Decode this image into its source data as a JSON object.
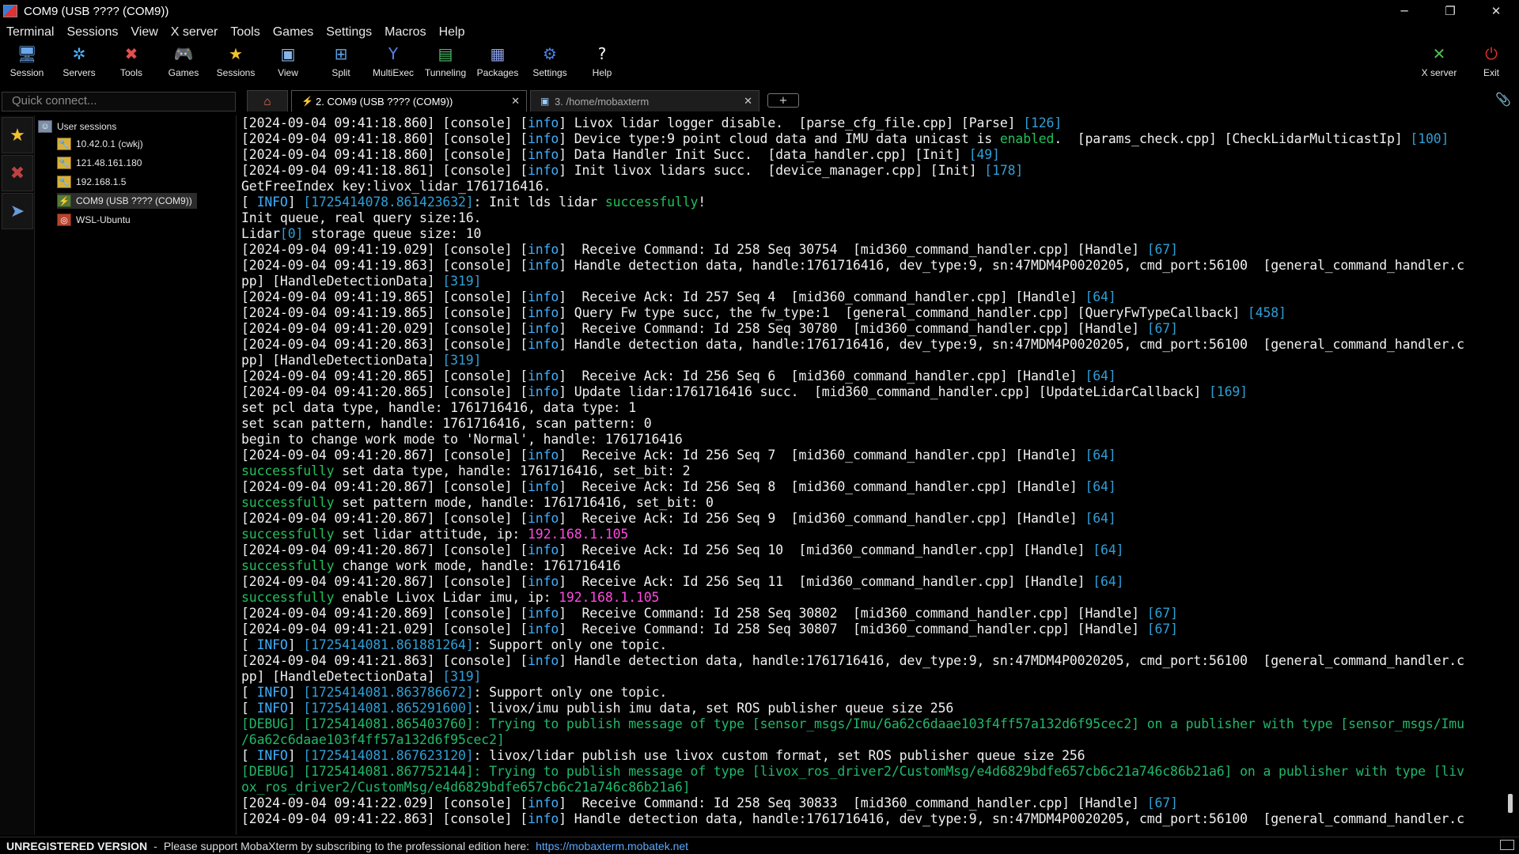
{
  "window": {
    "title": "COM9  (USB ???? (COM9))",
    "controls": {
      "minimize": "─",
      "restore": "❐",
      "close": "✕"
    }
  },
  "menubar": [
    "Terminal",
    "Sessions",
    "View",
    "X server",
    "Tools",
    "Games",
    "Settings",
    "Macros",
    "Help"
  ],
  "toolbar": {
    "left": [
      {
        "label": "Session",
        "icon": "session-icon",
        "glyph": "🖥",
        "color": "#6aa6e8"
      },
      {
        "label": "Servers",
        "icon": "servers-icon",
        "glyph": "✲",
        "color": "#4db3ff"
      },
      {
        "label": "Tools",
        "icon": "tools-icon",
        "glyph": "✖",
        "color": "#e05050"
      },
      {
        "label": "Games",
        "icon": "games-icon",
        "glyph": "🎮",
        "color": "#dddddd"
      },
      {
        "label": "Sessions",
        "icon": "star-icon",
        "glyph": "★",
        "color": "#f2c12e"
      },
      {
        "label": "View",
        "icon": "view-icon",
        "glyph": "▣",
        "color": "#8ab4e8"
      },
      {
        "label": "Split",
        "icon": "split-icon",
        "glyph": "⊞",
        "color": "#5aa0e0"
      },
      {
        "label": "MultiExec",
        "icon": "multiexec-icon",
        "glyph": "Y",
        "color": "#5a7fe0"
      },
      {
        "label": "Tunneling",
        "icon": "tunneling-icon",
        "glyph": "▤",
        "color": "#4fbf6a"
      },
      {
        "label": "Packages",
        "icon": "packages-icon",
        "glyph": "▦",
        "color": "#8aa0e8"
      },
      {
        "label": "Settings",
        "icon": "settings-icon",
        "glyph": "⚙",
        "color": "#4a80e0"
      },
      {
        "label": "Help",
        "icon": "help-icon",
        "glyph": "?",
        "color": "#ffffff"
      }
    ],
    "right": [
      {
        "label": "X server",
        "icon": "xserver-icon",
        "glyph": "✕",
        "color": "#4fbf4f"
      },
      {
        "label": "Exit",
        "icon": "power-icon",
        "glyph": "⏻",
        "color": "#e03030"
      }
    ]
  },
  "quick_connect": {
    "placeholder": "Quick connect..."
  },
  "tabs": {
    "home_glyph": "⌂",
    "items": [
      {
        "label": "2. COM9  (USB ???? (COM9))",
        "glyph": "⚡",
        "active": true
      },
      {
        "label": "3. /home/mobaxterm",
        "glyph": "▣",
        "active": false
      }
    ],
    "new_tab": "+",
    "clip_glyph": "📎"
  },
  "side_rail": [
    {
      "icon": "star-icon",
      "glyph": "★",
      "color": "#f2c12e"
    },
    {
      "icon": "tools-icon",
      "glyph": "✖",
      "color": "#c04040"
    },
    {
      "icon": "send-icon",
      "glyph": "➤",
      "color": "#6a9ad8"
    }
  ],
  "sessions_tree": {
    "root": "User sessions",
    "items": [
      {
        "label": "10.42.0.1 (cwkj)",
        "type": "ssh"
      },
      {
        "label": "121.48.161.180",
        "type": "ssh"
      },
      {
        "label": "192.168.1.5",
        "type": "ssh"
      },
      {
        "label": "COM9  (USB ???? (COM9))",
        "type": "serial",
        "selected": true
      },
      {
        "label": "WSL-Ubuntu",
        "type": "wsl"
      }
    ]
  },
  "terminal": {
    "lines": [
      [
        [
          "[2024-09-04 09:41:18.860] [console] [",
          ""
        ],
        [
          "info",
          "info"
        ],
        [
          "] Livox lidar logger disable.  [parse_cfg_file.cpp] [Parse] ",
          ""
        ],
        [
          "[126]",
          "num"
        ]
      ],
      [
        [
          "[2024-09-04 09:41:18.860] [console] [",
          ""
        ],
        [
          "info",
          "info"
        ],
        [
          "] Device type:9 point cloud data and IMU data unicast is ",
          ""
        ],
        [
          "enabled",
          "green"
        ],
        [
          ".  [params_check.cpp] [CheckLidarMulticastIp] ",
          ""
        ],
        [
          "[100]",
          "num"
        ]
      ],
      [
        [
          "[2024-09-04 09:41:18.860] [console] [",
          ""
        ],
        [
          "info",
          "info"
        ],
        [
          "] Data Handler Init Succ.  [data_handler.cpp] [Init] ",
          ""
        ],
        [
          "[49]",
          "num"
        ]
      ],
      [
        [
          "[2024-09-04 09:41:18.861] [console] [",
          ""
        ],
        [
          "info",
          "info"
        ],
        [
          "] Init livox lidars succ.  [device_manager.cpp] [Init] ",
          ""
        ],
        [
          "[178]",
          "num"
        ]
      ],
      [
        [
          "GetFreeIndex key:livox_lidar_1761716416.",
          ""
        ]
      ],
      [
        [
          "[ ",
          ""
        ],
        [
          "INFO",
          "info"
        ],
        [
          "] ",
          ""
        ],
        [
          "[1725414078.861423632]",
          "num"
        ],
        [
          ": Init lds lidar ",
          ""
        ],
        [
          "successfully",
          "green"
        ],
        [
          "!",
          ""
        ]
      ],
      [
        [
          "Init queue, real query size:16.",
          ""
        ]
      ],
      [
        [
          "Lidar",
          ""
        ],
        [
          "[0]",
          "num"
        ],
        [
          " storage queue size: 10",
          ""
        ]
      ],
      [
        [
          "[2024-09-04 09:41:19.029] [console] [",
          ""
        ],
        [
          "info",
          "info"
        ],
        [
          "]  Receive Command: Id 258 Seq 30754  [mid360_command_handler.cpp] [Handle] ",
          ""
        ],
        [
          "[67]",
          "num"
        ]
      ],
      [
        [
          "[2024-09-04 09:41:19.863] [console] [",
          ""
        ],
        [
          "info",
          "info"
        ],
        [
          "] Handle detection data, handle:1761716416, dev_type:9, sn:47MDM4P0020205, cmd_port:56100  [general_command_handler.c",
          ""
        ]
      ],
      [
        [
          "pp] [HandleDetectionData] ",
          ""
        ],
        [
          "[319]",
          "num"
        ]
      ],
      [
        [
          "[2024-09-04 09:41:19.865] [console] [",
          ""
        ],
        [
          "info",
          "info"
        ],
        [
          "]  Receive Ack: Id 257 Seq 4  [mid360_command_handler.cpp] [Handle] ",
          ""
        ],
        [
          "[64]",
          "num"
        ]
      ],
      [
        [
          "[2024-09-04 09:41:19.865] [console] [",
          ""
        ],
        [
          "info",
          "info"
        ],
        [
          "] Query Fw type succ, the fw_type:1  [general_command_handler.cpp] [QueryFwTypeCallback] ",
          ""
        ],
        [
          "[458]",
          "num"
        ]
      ],
      [
        [
          "[2024-09-04 09:41:20.029] [console] [",
          ""
        ],
        [
          "info",
          "info"
        ],
        [
          "]  Receive Command: Id 258 Seq 30780  [mid360_command_handler.cpp] [Handle] ",
          ""
        ],
        [
          "[67]",
          "num"
        ]
      ],
      [
        [
          "[2024-09-04 09:41:20.863] [console] [",
          ""
        ],
        [
          "info",
          "info"
        ],
        [
          "] Handle detection data, handle:1761716416, dev_type:9, sn:47MDM4P0020205, cmd_port:56100  [general_command_handler.c",
          ""
        ]
      ],
      [
        [
          "pp] [HandleDetectionData] ",
          ""
        ],
        [
          "[319]",
          "num"
        ]
      ],
      [
        [
          "[2024-09-04 09:41:20.865] [console] [",
          ""
        ],
        [
          "info",
          "info"
        ],
        [
          "]  Receive Ack: Id 256 Seq 6  [mid360_command_handler.cpp] [Handle] ",
          ""
        ],
        [
          "[64]",
          "num"
        ]
      ],
      [
        [
          "[2024-09-04 09:41:20.865] [console] [",
          ""
        ],
        [
          "info",
          "info"
        ],
        [
          "] Update lidar:1761716416 succ.  [mid360_command_handler.cpp] [UpdateLidarCallback] ",
          ""
        ],
        [
          "[169]",
          "num"
        ]
      ],
      [
        [
          "set pcl data type, handle: 1761716416, data type: 1",
          ""
        ]
      ],
      [
        [
          "set scan pattern, handle: 1761716416, scan pattern: 0",
          ""
        ]
      ],
      [
        [
          "begin to change work mode to 'Normal', handle: 1761716416",
          ""
        ]
      ],
      [
        [
          "[2024-09-04 09:41:20.867] [console] [",
          ""
        ],
        [
          "info",
          "info"
        ],
        [
          "]  Receive Ack: Id 256 Seq 7  [mid360_command_handler.cpp] [Handle] ",
          ""
        ],
        [
          "[64]",
          "num"
        ]
      ],
      [
        [
          "successfully",
          "green"
        ],
        [
          " set data type, handle: 1761716416, set_bit: 2",
          ""
        ]
      ],
      [
        [
          "[2024-09-04 09:41:20.867] [console] [",
          ""
        ],
        [
          "info",
          "info"
        ],
        [
          "]  Receive Ack: Id 256 Seq 8  [mid360_command_handler.cpp] [Handle] ",
          ""
        ],
        [
          "[64]",
          "num"
        ]
      ],
      [
        [
          "successfully",
          "green"
        ],
        [
          " set pattern mode, handle: 1761716416, set_bit: 0",
          ""
        ]
      ],
      [
        [
          "[2024-09-04 09:41:20.867] [console] [",
          ""
        ],
        [
          "info",
          "info"
        ],
        [
          "]  Receive Ack: Id 256 Seq 9  [mid360_command_handler.cpp] [Handle] ",
          ""
        ],
        [
          "[64]",
          "num"
        ]
      ],
      [
        [
          "successfully",
          "green"
        ],
        [
          " set lidar attitude, ip: ",
          ""
        ],
        [
          "192.168.1.105",
          "mag"
        ]
      ],
      [
        [
          "[2024-09-04 09:41:20.867] [console] [",
          ""
        ],
        [
          "info",
          "info"
        ],
        [
          "]  Receive Ack: Id 256 Seq 10  [mid360_command_handler.cpp] [Handle] ",
          ""
        ],
        [
          "[64]",
          "num"
        ]
      ],
      [
        [
          "successfully",
          "green"
        ],
        [
          " change work mode, handle: 1761716416",
          ""
        ]
      ],
      [
        [
          "[2024-09-04 09:41:20.867] [console] [",
          ""
        ],
        [
          "info",
          "info"
        ],
        [
          "]  Receive Ack: Id 256 Seq 11  [mid360_command_handler.cpp] [Handle] ",
          ""
        ],
        [
          "[64]",
          "num"
        ]
      ],
      [
        [
          "successfully",
          "green"
        ],
        [
          " enable Livox Lidar imu, ip: ",
          ""
        ],
        [
          "192.168.1.105",
          "mag"
        ]
      ],
      [
        [
          "[2024-09-04 09:41:20.869] [console] [",
          ""
        ],
        [
          "info",
          "info"
        ],
        [
          "]  Receive Command: Id 258 Seq 30802  [mid360_command_handler.cpp] [Handle] ",
          ""
        ],
        [
          "[67]",
          "num"
        ]
      ],
      [
        [
          "[2024-09-04 09:41:21.029] [console] [",
          ""
        ],
        [
          "info",
          "info"
        ],
        [
          "]  Receive Command: Id 258 Seq 30807  [mid360_command_handler.cpp] [Handle] ",
          ""
        ],
        [
          "[67]",
          "num"
        ]
      ],
      [
        [
          "[ ",
          ""
        ],
        [
          "INFO",
          "info"
        ],
        [
          "] ",
          ""
        ],
        [
          "[1725414081.861881264]",
          "num"
        ],
        [
          ": Support only one topic.",
          ""
        ]
      ],
      [
        [
          "[2024-09-04 09:41:21.863] [console] [",
          ""
        ],
        [
          "info",
          "info"
        ],
        [
          "] Handle detection data, handle:1761716416, dev_type:9, sn:47MDM4P0020205, cmd_port:56100  [general_command_handler.c",
          ""
        ]
      ],
      [
        [
          "pp] [HandleDetectionData] ",
          ""
        ],
        [
          "[319]",
          "num"
        ]
      ],
      [
        [
          "[ ",
          ""
        ],
        [
          "INFO",
          "info"
        ],
        [
          "] ",
          ""
        ],
        [
          "[1725414081.863786672]",
          "num"
        ],
        [
          ": Support only one topic.",
          ""
        ]
      ],
      [
        [
          "[ ",
          ""
        ],
        [
          "INFO",
          "info"
        ],
        [
          "] ",
          ""
        ],
        [
          "[1725414081.865291600]",
          "num"
        ],
        [
          ": livox/imu publish imu data, set ROS publisher queue size 256",
          ""
        ]
      ],
      [
        [
          "[DEBUG] [1725414081.865403760]: Trying to publish message of type [sensor_msgs/Imu/6a62c6daae103f4ff57a132d6f95cec2] on a publisher with type [sensor_msgs/Imu",
          "debug"
        ]
      ],
      [
        [
          "/6a62c6daae103f4ff57a132d6f95cec2]",
          "debug"
        ]
      ],
      [
        [
          "[ ",
          ""
        ],
        [
          "INFO",
          "info"
        ],
        [
          "] ",
          ""
        ],
        [
          "[1725414081.867623120]",
          "num"
        ],
        [
          ": livox/lidar publish use livox custom format, set ROS publisher queue size 256",
          ""
        ]
      ],
      [
        [
          "[DEBUG] [1725414081.867752144]: Trying to publish message of type [livox_ros_driver2/CustomMsg/e4d6829bdfe657cb6c21a746c86b21a6] on a publisher with type [liv",
          "debug"
        ]
      ],
      [
        [
          "ox_ros_driver2/CustomMsg/e4d6829bdfe657cb6c21a746c86b21a6]",
          "debug"
        ]
      ],
      [
        [
          "[2024-09-04 09:41:22.029] [console] [",
          ""
        ],
        [
          "info",
          "info"
        ],
        [
          "]  Receive Command: Id 258 Seq 30833  [mid360_command_handler.cpp] [Handle] ",
          ""
        ],
        [
          "[67]",
          "num"
        ]
      ],
      [
        [
          "[2024-09-04 09:41:22.863] [console] [",
          ""
        ],
        [
          "info",
          "info"
        ],
        [
          "] Handle detection data, handle:1761716416, dev_type:9, sn:47MDM4P0020205, cmd_port:56100  [general_command_handler.c",
          ""
        ]
      ]
    ]
  },
  "statusbar": {
    "unregistered": "UNREGISTERED VERSION",
    "separator": "-",
    "message": "Please support MobaXterm by subscribing to the professional edition here:",
    "link": "https://mobaxterm.mobatek.net"
  }
}
